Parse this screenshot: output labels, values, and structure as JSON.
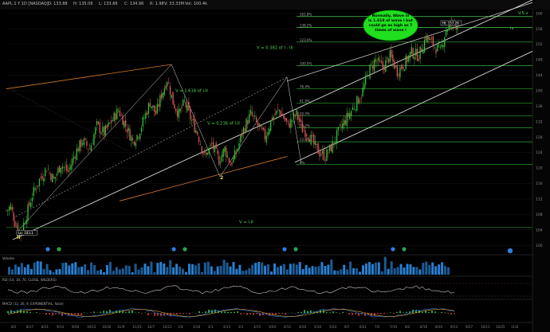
{
  "window": {
    "title": "AAPL 1 Y 1D [NASDAQ]",
    "stats": [
      "O: 133.88",
      "H: 135.06",
      "L: 133.66",
      "C: 134.96",
      "R: 1.98",
      "V: 33.33M",
      "Vol: 100.4k"
    ]
  },
  "annotations": {
    "callout": [
      "Normally, Wave iii",
      "is 1.618 of wave i but",
      "could go as high as 7",
      "times of wave i"
    ],
    "fib_labels": [
      {
        "text": "161.8%",
        "price": 159.2
      },
      {
        "text": "138.2%",
        "price": 156.4
      },
      {
        "text": "123.6%",
        "price": 152.6
      },
      {
        "text": "100.0%",
        "price": 146.5
      },
      {
        "text": "76.4%",
        "price": 140.5
      },
      {
        "text": "61.8%",
        "price": 136.8
      },
      {
        "text": "50.0%",
        "price": 133.5
      },
      {
        "text": "38.2%",
        "price": 130.4
      },
      {
        "text": "23.6%",
        "price": 126.8
      },
      {
        "text": "0%",
        "price": 120.9
      }
    ],
    "wave_labels": [
      {
        "text": "V = 0.382 of I - III",
        "x": 322,
        "price": 150.8
      },
      {
        "text": "V = 1.618 of I-II",
        "x": 220,
        "price": 139.7
      },
      {
        "text": "V = 0.236 of I-II",
        "x": 260,
        "price": 131.3
      },
      {
        "text": "V = I-II",
        "x": 300,
        "price": 105.7
      },
      {
        "text": "V.5.v",
        "x": 650,
        "price": 159.8
      },
      {
        "text": "iv",
        "x": 640,
        "price": 155.9
      }
    ],
    "wave_counts": [
      {
        "text": "2",
        "x": 276,
        "price": 117.1
      },
      {
        "text": "II",
        "x": 21,
        "price": 101.7
      }
    ],
    "price_tags": [
      {
        "text": "Lo: 103.1",
        "x": 22,
        "price": 103.1
      },
      {
        "text": "Hi: 157.26",
        "x": 554,
        "price": 157.3
      }
    ]
  },
  "panels": {
    "volume_label": "Volume",
    "rsi_label": "RSI (14, 30, 70, CLOSE, WILDERS)",
    "macd_label": "MACD (12, 26, 9, EXPONENTIAL, false)"
  },
  "chart_data": {
    "type": "candlestick",
    "symbol": "AAPL",
    "interval": "1D",
    "ylim": [
      98,
      161
    ],
    "y_ticks": [
      100,
      104,
      108,
      112,
      116,
      120,
      124,
      128,
      132,
      136,
      140,
      144,
      148,
      152,
      156,
      160
    ],
    "x_ticks": [
      "8/3",
      "8/17",
      "8/31",
      "9/14",
      "9/28",
      "10/12",
      "10/26",
      "11/9",
      "11/23",
      "12/7",
      "12/21",
      "1/4",
      "1/18",
      "2/1",
      "2/15",
      "3/1",
      "3/15",
      "3/29",
      "4/12",
      "4/26",
      "5/10",
      "5/24",
      "6/7",
      "6/21",
      "7/5",
      "7/19",
      "8/2",
      "8/16",
      "8/30",
      "9/13",
      "9/27",
      "10/11",
      "10/25",
      "11/8"
    ],
    "price_path": [
      [
        0,
        109
      ],
      [
        3,
        110
      ],
      [
        6,
        106
      ],
      [
        10,
        103.1
      ],
      [
        14,
        108
      ],
      [
        18,
        113
      ],
      [
        23,
        117
      ],
      [
        28,
        120
      ],
      [
        33,
        117
      ],
      [
        38,
        121
      ],
      [
        43,
        119
      ],
      [
        48,
        124
      ],
      [
        53,
        127
      ],
      [
        58,
        125
      ],
      [
        63,
        131
      ],
      [
        68,
        129
      ],
      [
        73,
        132
      ],
      [
        78,
        135
      ],
      [
        83,
        131
      ],
      [
        88,
        127
      ],
      [
        92,
        129
      ],
      [
        96,
        133
      ],
      [
        100,
        137
      ],
      [
        104,
        134
      ],
      [
        108,
        139
      ],
      [
        112,
        143
      ],
      [
        116,
        137
      ],
      [
        120,
        134
      ],
      [
        124,
        137
      ],
      [
        128,
        133
      ],
      [
        133,
        129
      ],
      [
        138,
        123
      ],
      [
        143,
        126
      ],
      [
        148,
        122
      ],
      [
        152,
        125
      ],
      [
        156,
        121
      ],
      [
        160,
        124
      ],
      [
        165,
        130
      ],
      [
        170,
        134
      ],
      [
        175,
        131
      ],
      [
        180,
        128
      ],
      [
        185,
        133
      ],
      [
        190,
        135
      ],
      [
        196,
        131
      ],
      [
        202,
        134
      ],
      [
        206,
        130
      ],
      [
        210,
        129
      ],
      [
        214,
        126
      ],
      [
        218,
        124
      ],
      [
        222,
        123
      ],
      [
        227,
        126
      ],
      [
        232,
        130
      ],
      [
        237,
        133
      ],
      [
        242,
        136
      ],
      [
        247,
        139
      ],
      [
        252,
        145
      ],
      [
        257,
        148
      ],
      [
        262,
        146
      ],
      [
        267,
        149
      ],
      [
        272,
        145
      ],
      [
        277,
        147
      ],
      [
        282,
        150
      ],
      [
        287,
        149
      ],
      [
        292,
        154
      ],
      [
        297,
        152
      ],
      [
        302,
        150
      ],
      [
        306,
        156
      ],
      [
        310,
        157.3
      ],
      [
        314,
        157
      ]
    ],
    "volume_bars": 140,
    "rsi_bounds": [
      30,
      70
    ]
  }
}
